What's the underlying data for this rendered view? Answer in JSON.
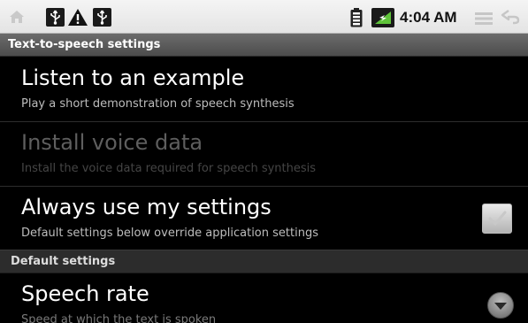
{
  "status_bar": {
    "time": "4:04 AM",
    "icons": [
      "home-icon",
      "usb-icon",
      "warning-icon",
      "usb-icon",
      "battery-icon",
      "signal-icon",
      "menu-icon",
      "back-icon"
    ]
  },
  "title_bar": {
    "title": "Text-to-speech settings"
  },
  "preferences": [
    {
      "title": "Listen to an example",
      "summary": "Play a short demonstration of speech synthesis",
      "enabled": true
    },
    {
      "title": "Install voice data",
      "summary": "Install the voice data required for speech synthesis",
      "enabled": false
    },
    {
      "title": "Always use my settings",
      "summary": "Default settings below override application settings",
      "enabled": true,
      "checkbox_checked": true
    }
  ],
  "section_header": "Default settings",
  "default_settings": [
    {
      "title": "Speech rate",
      "summary": "Speed at which the text is spoken",
      "control": "dropdown-icon"
    }
  ],
  "colors": {
    "status_bar_bg": "#ececec",
    "title_bar_bg": "#5a5a5a",
    "background": "#000000",
    "section_header_bg": "#2c2c2c",
    "disabled_text": "#5e5e5e"
  }
}
